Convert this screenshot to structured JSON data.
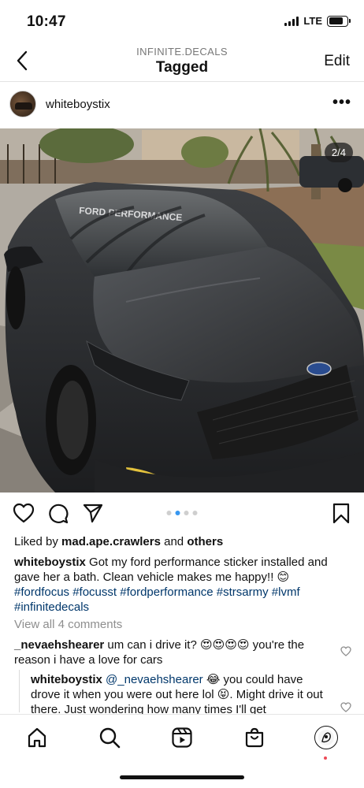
{
  "status": {
    "time": "10:47",
    "network": "LTE"
  },
  "header": {
    "subtitle": "INFINITE.DECALS",
    "title": "Tagged",
    "edit_label": "Edit"
  },
  "post": {
    "username": "whiteboystix",
    "more_label": "•••",
    "photo_counter": "2/4",
    "photo_text": "FORD PERFORMANCE",
    "carousel": {
      "total": 4,
      "active_index": 1
    },
    "likes": {
      "prefix": "Liked by ",
      "user": "mad.ape.crawlers",
      "middle": " and ",
      "others": "others"
    },
    "caption": {
      "username": "whiteboystix",
      "text": " Got my ford performance sticker installed and gave her a bath.  Clean vehicle makes me happy!! 😊",
      "hashtags": "#fordfocus #focusst #fordperformance #strsarmy  #lvmf #infinitedecals"
    },
    "view_comments": "View all 4 comments",
    "comments": [
      {
        "username": "_nevaehshearer",
        "text": " um can i drive it? 😍😍😍😍 you're the reason i have a love for cars"
      },
      {
        "username": "whiteboystix",
        "mention": "@_nevaehshearer",
        "text": " 😂 you could have drove it when you were out here lol 😝. Might drive it out there. Just wondering how many times I'll get"
      }
    ]
  },
  "colors": {
    "link": "#00376b",
    "muted": "#8e8e8e",
    "active_dot": "#3897f0",
    "notification": "#ed4956"
  },
  "icons": {
    "back": "chevron-left-icon",
    "like": "heart-icon",
    "comment": "comment-icon",
    "share": "paper-plane-icon",
    "save": "bookmark-icon",
    "home": "home-icon",
    "search": "search-icon",
    "reels": "reels-icon",
    "shop": "shop-bag-icon",
    "profile": "profile-avatar-icon"
  }
}
